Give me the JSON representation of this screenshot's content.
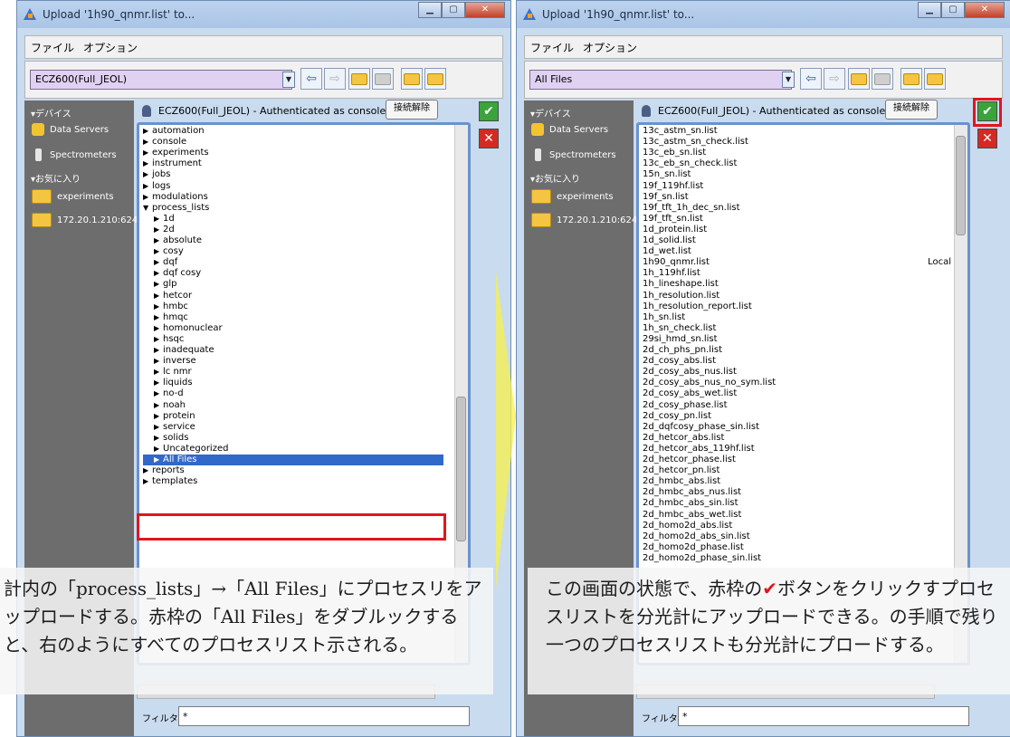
{
  "window_title": "Upload '1h90_qnmr.list' to...",
  "menu": [
    "ファイル",
    "オプション"
  ],
  "left": {
    "combo_value": "ECZ600(Full_JEOL)",
    "connection_text": "ECZ600(Full_JEOL) - Authenticated as console",
    "disconnect_label": "接続解除",
    "sidebar": {
      "devices_header": "▾デバイス",
      "devices": [
        "Data Servers",
        "Spectrometers"
      ],
      "favorites_header": "▾お気に入り",
      "favorites": [
        "experiments",
        "172.20.1.210:6242"
      ]
    },
    "tree": [
      {
        "label": "automation",
        "indent": 0,
        "arrow": "▶"
      },
      {
        "label": "console",
        "indent": 0,
        "arrow": "▶"
      },
      {
        "label": "experiments",
        "indent": 0,
        "arrow": "▶"
      },
      {
        "label": "instrument",
        "indent": 0,
        "arrow": "▶"
      },
      {
        "label": "jobs",
        "indent": 0,
        "arrow": "▶"
      },
      {
        "label": "logs",
        "indent": 0,
        "arrow": "▶"
      },
      {
        "label": "modulations",
        "indent": 0,
        "arrow": "▶"
      },
      {
        "label": "process_lists",
        "indent": 0,
        "arrow": "▼"
      },
      {
        "label": "1d",
        "indent": 1,
        "arrow": "▶"
      },
      {
        "label": "2d",
        "indent": 1,
        "arrow": "▶"
      },
      {
        "label": "absolute",
        "indent": 1,
        "arrow": "▶"
      },
      {
        "label": "cosy",
        "indent": 1,
        "arrow": "▶"
      },
      {
        "label": "dqf",
        "indent": 1,
        "arrow": "▶"
      },
      {
        "label": "dqf cosy",
        "indent": 1,
        "arrow": "▶"
      },
      {
        "label": "glp",
        "indent": 1,
        "arrow": "▶"
      },
      {
        "label": "hetcor",
        "indent": 1,
        "arrow": "▶"
      },
      {
        "label": "hmbc",
        "indent": 1,
        "arrow": "▶"
      },
      {
        "label": "hmqc",
        "indent": 1,
        "arrow": "▶"
      },
      {
        "label": "homonuclear",
        "indent": 1,
        "arrow": "▶"
      },
      {
        "label": "hsqc",
        "indent": 1,
        "arrow": "▶"
      },
      {
        "label": "inadequate",
        "indent": 1,
        "arrow": "▶"
      },
      {
        "label": "inverse",
        "indent": 1,
        "arrow": "▶"
      },
      {
        "label": "lc nmr",
        "indent": 1,
        "arrow": "▶"
      },
      {
        "label": "liquids",
        "indent": 1,
        "arrow": "▶"
      },
      {
        "label": "no-d",
        "indent": 1,
        "arrow": "▶"
      },
      {
        "label": "noah",
        "indent": 1,
        "arrow": "▶"
      },
      {
        "label": "protein",
        "indent": 1,
        "arrow": "▶"
      },
      {
        "label": "service",
        "indent": 1,
        "arrow": "▶"
      },
      {
        "label": "solids",
        "indent": 1,
        "arrow": "▶"
      },
      {
        "label": "Uncategorized",
        "indent": 1,
        "arrow": "▶"
      },
      {
        "label": "All Files",
        "indent": 1,
        "arrow": "▶",
        "selected": true
      },
      {
        "label": "reports",
        "indent": 0,
        "arrow": "▶"
      },
      {
        "label": "templates",
        "indent": 0,
        "arrow": "▶"
      }
    ],
    "filter_label": "フィルタ:",
    "filter_value": "*",
    "caption": "計内の「process_lists」→「All Files」にプロセスリをアップロードする。赤枠の「All Files」をダブルックすると、右のようにすべてのプロセスリスト示される。"
  },
  "right": {
    "combo_value": "All Files",
    "connection_text": "ECZ600(Full_JEOL) - Authenticated as console",
    "disconnect_label": "接続解除",
    "sidebar": {
      "devices_header": "▾デバイス",
      "devices": [
        "Data Servers",
        "Spectrometers"
      ],
      "favorites_header": "▾お気に入り",
      "favorites": [
        "experiments",
        "172.20.1.210:6242"
      ]
    },
    "files": [
      "13c_astm_sn.list",
      "13c_astm_sn_check.list",
      "13c_eb_sn.list",
      "13c_eb_sn_check.list",
      "15n_sn.list",
      "19f_119hf.list",
      "19f_sn.list",
      "19f_tft_1h_dec_sn.list",
      "19f_tft_sn.list",
      "1d_protein.list",
      "1d_solid.list",
      "1d_wet.list",
      "1h90_qnmr.list",
      "1h_119hf.list",
      "1h_lineshape.list",
      "1h_resolution.list",
      "1h_resolution_report.list",
      "1h_sn.list",
      "1h_sn_check.list",
      "29si_hmd_sn.list",
      "2d_ch_phs_pn.list",
      "2d_cosy_abs.list",
      "2d_cosy_abs_nus.list",
      "2d_cosy_abs_nus_no_sym.list",
      "2d_cosy_abs_wet.list",
      "2d_cosy_phase.list",
      "2d_cosy_pn.list",
      "2d_dqfcosy_phase_sin.list",
      "2d_hetcor_abs.list",
      "2d_hetcor_abs_119hf.list",
      "2d_hetcor_phase.list",
      "2d_hetcor_pn.list",
      "2d_hmbc_abs.list",
      "2d_hmbc_abs_nus.list",
      "2d_hmbc_abs_sin.list",
      "2d_hmbc_abs_wet.list",
      "2d_homo2d_abs.list",
      "2d_homo2d_abs_sin.list",
      "2d_homo2d_phase.list",
      "2d_homo2d_phase_sin.list"
    ],
    "local_label": "Local",
    "filter_label": "フィルタ:",
    "filter_value": "*",
    "caption_before": "この画面の状態で、赤枠の",
    "caption_check": "✔",
    "caption_after": "ボタンをクリックすプロセスリストを分光計にアップロードできる。の手順で残り一つのプロセスリストも分光計にプロードする。"
  }
}
